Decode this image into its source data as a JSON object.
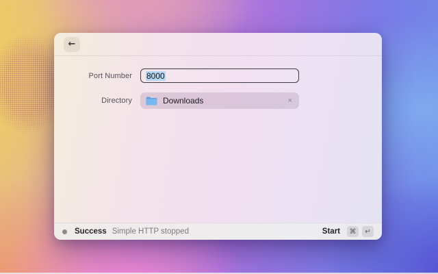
{
  "window": {
    "header": {
      "back_icon": "←"
    },
    "form": {
      "port": {
        "label": "Port Number",
        "value": "8000"
      },
      "directory": {
        "label": "Directory",
        "value": "Downloads",
        "remove_icon": "×"
      }
    },
    "footer": {
      "status_title": "Success",
      "status_message": "Simple HTTP stopped",
      "action_label": "Start",
      "key_cmd": "⌘",
      "key_enter": "↵"
    }
  },
  "colors": {
    "folder_blue": "#64a7e8",
    "selection_highlight": "#b3d7f2",
    "status_dot": "#8e8a8e",
    "wallpaper_yellow": "#ecc96c",
    "wallpaper_pink": "#ee85d6",
    "wallpaper_purple": "#a873de",
    "wallpaper_blue": "#6d8fe8"
  }
}
